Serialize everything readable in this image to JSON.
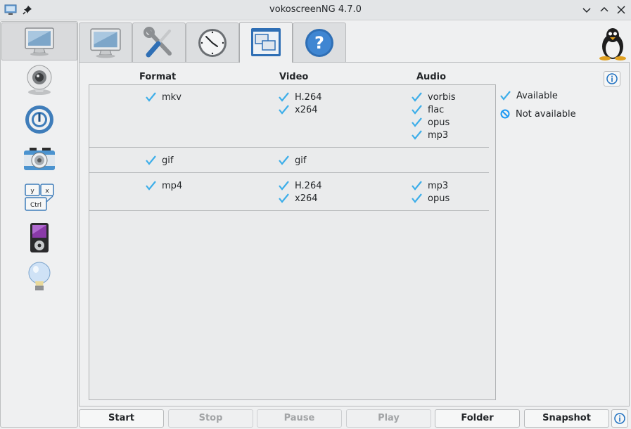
{
  "window": {
    "title": "vokoscreenNG 4.7.0",
    "icons": [
      "app-icon",
      "pin-icon",
      "minimize-icon",
      "maximize-icon",
      "close-icon"
    ]
  },
  "sidebar": {
    "items": [
      {
        "name": "screencast",
        "icon": "monitor-icon",
        "active": true
      },
      {
        "name": "camera",
        "icon": "webcam-icon"
      },
      {
        "name": "player",
        "icon": "power-ring-icon"
      },
      {
        "name": "snapshot",
        "icon": "camera-icon"
      },
      {
        "name": "hotkeys",
        "icon": "keyboard-keys-icon"
      },
      {
        "name": "player-device",
        "icon": "media-player-icon"
      },
      {
        "name": "tips",
        "icon": "lightbulb-icon"
      }
    ]
  },
  "tabs": [
    {
      "name": "screen",
      "icon": "monitor-icon"
    },
    {
      "name": "tools",
      "icon": "wrench-screwdriver-icon"
    },
    {
      "name": "timer",
      "icon": "clock-icon"
    },
    {
      "name": "codecs",
      "icon": "windows-icon",
      "active": true
    },
    {
      "name": "help",
      "icon": "question-icon"
    }
  ],
  "codecs": {
    "headers": {
      "format": "Format",
      "video": "Video",
      "audio": "Audio"
    },
    "groups": [
      {
        "format": "mkv",
        "video": [
          "H.264",
          "x264"
        ],
        "audio": [
          "vorbis",
          "flac",
          "opus",
          "mp3"
        ]
      },
      {
        "format": "gif",
        "video": [
          "gif"
        ],
        "audio": []
      },
      {
        "format": "mp4",
        "video": [
          "H.264",
          "x264"
        ],
        "audio": [
          "mp3",
          "opus"
        ]
      }
    ]
  },
  "legend": {
    "available": "Available",
    "not_available": "Not available"
  },
  "colors": {
    "check": "#3daee9",
    "not_available": "#1d99f3"
  },
  "bottom": {
    "start": "Start",
    "stop": "Stop",
    "pause": "Pause",
    "play": "Play",
    "folder": "Folder",
    "snapshot": "Snapshot"
  }
}
